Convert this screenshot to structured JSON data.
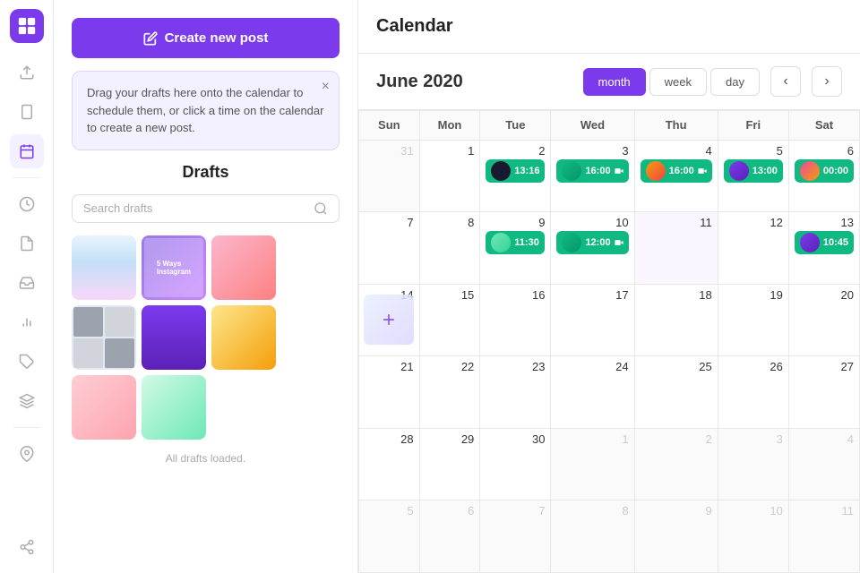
{
  "sidebar": {
    "logo_label": "Logo",
    "items": [
      {
        "id": "upload",
        "icon": "upload-icon",
        "label": "Upload"
      },
      {
        "id": "mobile",
        "icon": "mobile-icon",
        "label": "Mobile"
      },
      {
        "id": "calendar",
        "icon": "calendar-icon",
        "label": "Calendar",
        "active": true
      },
      {
        "id": "clock",
        "icon": "clock-icon",
        "label": "Schedule"
      },
      {
        "id": "draft",
        "icon": "draft-icon",
        "label": "Drafts"
      },
      {
        "id": "inbox",
        "icon": "inbox-icon",
        "label": "Inbox"
      },
      {
        "id": "analytics",
        "icon": "analytics-icon",
        "label": "Analytics"
      },
      {
        "id": "tags",
        "icon": "tags-icon",
        "label": "Tags"
      },
      {
        "id": "layers",
        "icon": "layers-icon",
        "label": "Layers"
      },
      {
        "id": "pin",
        "icon": "pin-icon",
        "label": "Pin"
      },
      {
        "id": "share",
        "icon": "share-icon",
        "label": "Share"
      }
    ]
  },
  "left_panel": {
    "create_btn_label": "Create new post",
    "tooltip_text": "Drag your drafts here onto the calendar to schedule them, or click a time on the calendar to create a new post.",
    "drafts_title": "Drafts",
    "search_placeholder": "Search drafts",
    "drafts_loaded_text": "All drafts loaded."
  },
  "page_header": {
    "title": "Calendar"
  },
  "cal_header": {
    "month_title": "June 2020",
    "view_month": "month",
    "view_week": "week",
    "view_day": "day",
    "prev_label": "‹",
    "next_label": "›"
  },
  "calendar": {
    "day_headers": [
      "Sun",
      "Mon",
      "Tue",
      "Wed",
      "Thu",
      "Fri",
      "Sat"
    ],
    "weeks": [
      [
        {
          "date": "31",
          "other": true,
          "events": []
        },
        {
          "date": "1",
          "events": []
        },
        {
          "date": "2",
          "events": [
            {
              "time": "13:16",
              "thumb_class": "thumb-circle-1"
            }
          ]
        },
        {
          "date": "3",
          "events": [
            {
              "time": "16:00",
              "thumb_class": "thumb-circle-2"
            }
          ]
        },
        {
          "date": "4",
          "events": [
            {
              "time": "16:00",
              "thumb_class": "thumb-circle-3"
            }
          ]
        },
        {
          "date": "5",
          "events": [
            {
              "time": "13:00",
              "thumb_class": "thumb-circle-4"
            }
          ]
        },
        {
          "date": "6",
          "events": [
            {
              "time": "00:00",
              "thumb_class": "thumb-circle-5"
            }
          ]
        }
      ],
      [
        {
          "date": "7",
          "events": []
        },
        {
          "date": "8",
          "events": []
        },
        {
          "date": "9",
          "events": [
            {
              "time": "11:30",
              "thumb_class": "thumb-circle-6"
            }
          ]
        },
        {
          "date": "10",
          "events": [
            {
              "time": "12:00",
              "thumb_class": "thumb-circle-7"
            }
          ]
        },
        {
          "date": "11",
          "today": true,
          "events": []
        },
        {
          "date": "12",
          "events": []
        },
        {
          "date": "13",
          "events": [
            {
              "time": "10:45",
              "thumb_class": "thumb-circle-4"
            }
          ]
        }
      ],
      [
        {
          "date": "14",
          "drag": true,
          "events": []
        },
        {
          "date": "15",
          "events": []
        },
        {
          "date": "16",
          "events": []
        },
        {
          "date": "17",
          "events": []
        },
        {
          "date": "18",
          "events": []
        },
        {
          "date": "19",
          "events": []
        },
        {
          "date": "20",
          "events": []
        }
      ],
      [
        {
          "date": "21",
          "events": []
        },
        {
          "date": "22",
          "events": []
        },
        {
          "date": "23",
          "events": []
        },
        {
          "date": "24",
          "events": []
        },
        {
          "date": "25",
          "events": []
        },
        {
          "date": "26",
          "events": []
        },
        {
          "date": "27",
          "events": []
        }
      ],
      [
        {
          "date": "28",
          "events": []
        },
        {
          "date": "29",
          "events": []
        },
        {
          "date": "30",
          "events": []
        },
        {
          "date": "1",
          "other": true,
          "events": []
        },
        {
          "date": "2",
          "other": true,
          "events": []
        },
        {
          "date": "3",
          "other": true,
          "events": []
        },
        {
          "date": "4",
          "other": true,
          "events": []
        }
      ],
      [
        {
          "date": "5",
          "other": true,
          "events": []
        },
        {
          "date": "6",
          "other": true,
          "events": []
        },
        {
          "date": "7",
          "other": true,
          "events": []
        },
        {
          "date": "8",
          "other": true,
          "events": []
        },
        {
          "date": "9",
          "other": true,
          "events": []
        },
        {
          "date": "10",
          "other": true,
          "events": []
        },
        {
          "date": "11",
          "other": true,
          "events": []
        }
      ]
    ]
  }
}
